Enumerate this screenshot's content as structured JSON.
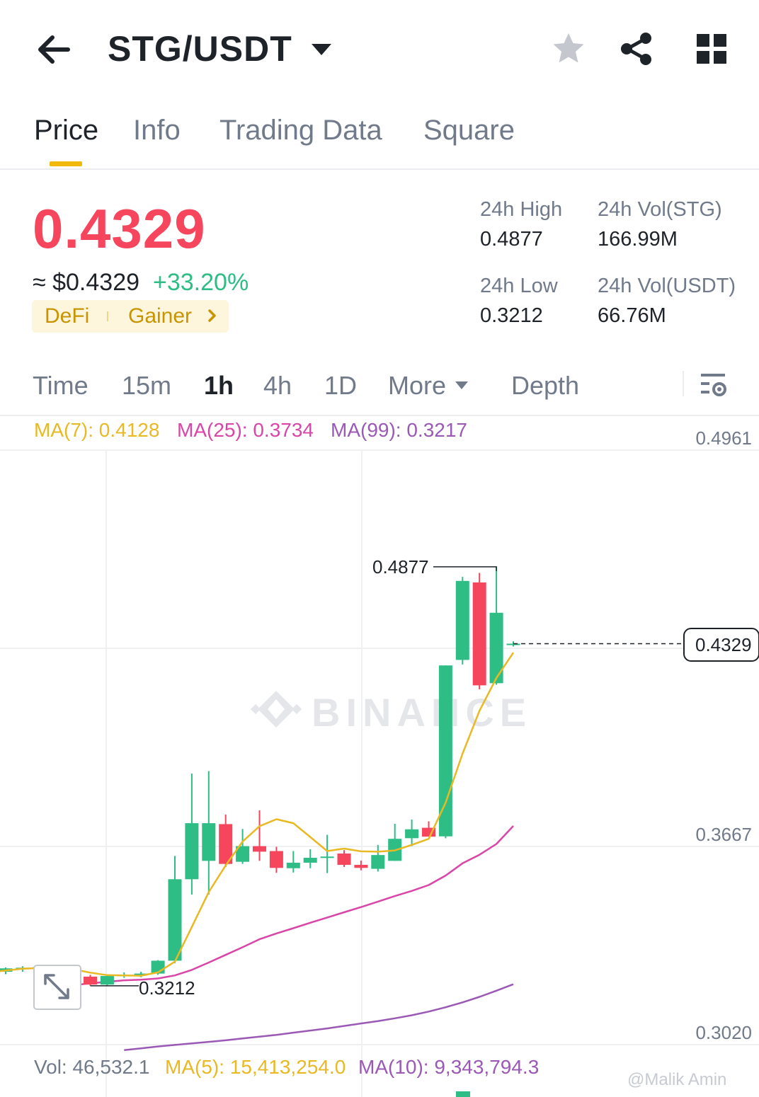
{
  "header": {
    "pair": "STG/USDT",
    "icons": {
      "back": "back-arrow-icon",
      "caret": "caret-down-icon",
      "star": "star-icon",
      "share": "share-icon",
      "grid": "grid-icon"
    }
  },
  "tabs": [
    {
      "label": "Price",
      "active": true
    },
    {
      "label": "Info",
      "active": false
    },
    {
      "label": "Trading Data",
      "active": false
    },
    {
      "label": "Square",
      "active": false
    }
  ],
  "ticker": {
    "last_price": "0.4329",
    "usd_price": "≈ $0.4329",
    "change": "+33.20%",
    "tags": [
      "DeFi",
      "Gainer"
    ]
  },
  "stats": {
    "high_label": "24h High",
    "high_value": "0.4877",
    "low_label": "24h Low",
    "low_value": "0.3212",
    "vol_base_label": "24h Vol(STG)",
    "vol_base_value": "166.99M",
    "vol_quote_label": "24h Vol(USDT)",
    "vol_quote_value": "66.76M"
  },
  "intervals": {
    "items": [
      "Time",
      "15m",
      "1h",
      "4h",
      "1D",
      "More",
      "Depth"
    ],
    "active": "1h"
  },
  "ma_legend": {
    "ma7": "MA(7): 0.4128",
    "ma25": "MA(25): 0.3734",
    "ma99": "MA(99): 0.3217"
  },
  "volume_legend": {
    "vol": "Vol: 46,532.1",
    "ma5": "MA(5): 15,413,254.0",
    "ma10": "MA(10): 9,343,794.3"
  },
  "watermark": "@Malik Amin",
  "colors": {
    "up": "#2ebd85",
    "down": "#f6465d",
    "accent": "#f0b90b",
    "ma7": "#e8b923",
    "ma25": "#d946a8",
    "ma99": "#9b59b6"
  },
  "chart_data": {
    "type": "candlestick",
    "interval": "1h",
    "y_axis_labels": [
      "0.4961",
      "0.3667",
      "0.3020"
    ],
    "ylim": [
      0.2988,
      0.5039
    ],
    "high_marker": "0.4877",
    "low_marker": "0.3212",
    "last_price_label": "0.4329",
    "candles": [
      {
        "o": 0.326,
        "h": 0.3268,
        "l": 0.3244,
        "c": 0.3258
      },
      {
        "o": 0.3258,
        "h": 0.3272,
        "l": 0.325,
        "c": 0.3269
      },
      {
        "o": 0.3268,
        "h": 0.3276,
        "l": 0.3258,
        "c": 0.3271
      },
      {
        "o": 0.327,
        "h": 0.3278,
        "l": 0.3262,
        "c": 0.3273
      },
      {
        "o": 0.3272,
        "h": 0.3276,
        "l": 0.3255,
        "c": 0.326
      },
      {
        "o": 0.3258,
        "h": 0.3262,
        "l": 0.324,
        "c": 0.3243
      },
      {
        "o": 0.3242,
        "h": 0.3248,
        "l": 0.3212,
        "c": 0.3216
      },
      {
        "o": 0.3216,
        "h": 0.3246,
        "l": 0.3212,
        "c": 0.3244
      },
      {
        "o": 0.3244,
        "h": 0.3256,
        "l": 0.3238,
        "c": 0.3248
      },
      {
        "o": 0.3248,
        "h": 0.3258,
        "l": 0.324,
        "c": 0.3252
      },
      {
        "o": 0.3252,
        "h": 0.3296,
        "l": 0.3248,
        "c": 0.3294
      },
      {
        "o": 0.3294,
        "h": 0.3636,
        "l": 0.3286,
        "c": 0.356
      },
      {
        "o": 0.356,
        "h": 0.3905,
        "l": 0.351,
        "c": 0.3743
      },
      {
        "o": 0.362,
        "h": 0.3913,
        "l": 0.351,
        "c": 0.3743
      },
      {
        "o": 0.374,
        "h": 0.3771,
        "l": 0.36,
        "c": 0.361
      },
      {
        "o": 0.3617,
        "h": 0.3724,
        "l": 0.361,
        "c": 0.3668
      },
      {
        "o": 0.3668,
        "h": 0.3785,
        "l": 0.362,
        "c": 0.365
      },
      {
        "o": 0.3652,
        "h": 0.3666,
        "l": 0.3581,
        "c": 0.3597
      },
      {
        "o": 0.3596,
        "h": 0.3652,
        "l": 0.3582,
        "c": 0.3614
      },
      {
        "o": 0.3614,
        "h": 0.3658,
        "l": 0.3596,
        "c": 0.363
      },
      {
        "o": 0.363,
        "h": 0.3705,
        "l": 0.358,
        "c": 0.3634
      },
      {
        "o": 0.3644,
        "h": 0.3655,
        "l": 0.36,
        "c": 0.3607
      },
      {
        "o": 0.3607,
        "h": 0.3621,
        "l": 0.3589,
        "c": 0.3597
      },
      {
        "o": 0.3594,
        "h": 0.3672,
        "l": 0.3585,
        "c": 0.3639
      },
      {
        "o": 0.362,
        "h": 0.3741,
        "l": 0.362,
        "c": 0.3692
      },
      {
        "o": 0.3694,
        "h": 0.3755,
        "l": 0.3668,
        "c": 0.3723
      },
      {
        "o": 0.3728,
        "h": 0.3749,
        "l": 0.37,
        "c": 0.3699
      },
      {
        "o": 0.37,
        "h": 0.4258,
        "l": 0.3694,
        "c": 0.4258
      },
      {
        "o": 0.4276,
        "h": 0.4547,
        "l": 0.4261,
        "c": 0.4534
      },
      {
        "o": 0.4529,
        "h": 0.456,
        "l": 0.418,
        "c": 0.4193
      },
      {
        "o": 0.42,
        "h": 0.458,
        "l": 0.4195,
        "c": 0.443
      },
      {
        "o": 0.4326,
        "h": 0.4337,
        "l": 0.432,
        "c": 0.4329
      }
    ],
    "ma7": [
      0.3256,
      0.3262,
      0.3268,
      0.327,
      0.3268,
      0.3266,
      0.3255,
      0.3247,
      0.3246,
      0.3245,
      0.3256,
      0.3291,
      0.3404,
      0.3518,
      0.3605,
      0.3683,
      0.3733,
      0.3756,
      0.3743,
      0.3698,
      0.3652,
      0.366,
      0.3651,
      0.365,
      0.3654,
      0.3672,
      0.3692,
      0.381,
      0.397,
      0.411,
      0.4217,
      0.43
    ],
    "ma25": [
      0.3208,
      0.3214,
      0.322,
      0.3225,
      0.323,
      0.3232,
      0.3236,
      0.3246,
      0.3264,
      0.3288,
      0.3313,
      0.3338,
      0.3364,
      0.3383,
      0.34,
      0.3418,
      0.3435,
      0.3452,
      0.3469,
      0.3487,
      0.3505,
      0.3522,
      0.3541,
      0.3572,
      0.3612,
      0.364,
      0.3675,
      0.3734
    ],
    "ma99": [
      0.3002,
      0.3008,
      0.3014,
      0.3019,
      0.3024,
      0.3029,
      0.3034,
      0.304,
      0.3046,
      0.3052,
      0.3059,
      0.3066,
      0.3073,
      0.3081,
      0.3089,
      0.3097,
      0.3106,
      0.3116,
      0.3128,
      0.3142,
      0.3158,
      0.3176,
      0.3196,
      0.3217
    ]
  }
}
